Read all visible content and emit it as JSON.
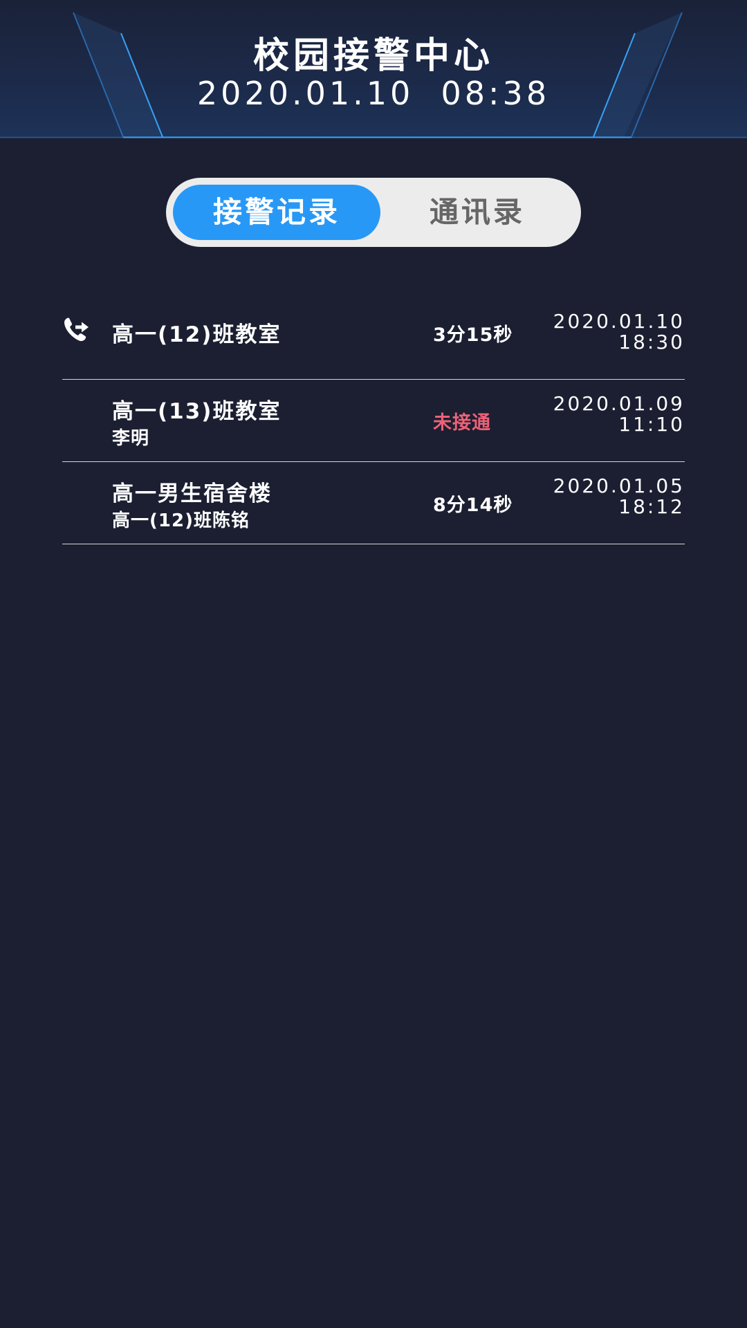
{
  "header": {
    "title": "校园接警中心",
    "datetime": "2020.01.10  08:38"
  },
  "tabs": [
    {
      "label": "接警记录",
      "active": true
    },
    {
      "label": "通讯录",
      "active": false
    }
  ],
  "records": [
    {
      "title": "高一(12)班教室",
      "subtitle": "",
      "status": "3分15秒",
      "missed": false,
      "date": "2020.01.10",
      "time": "18:30",
      "icon": "call-forward-icon"
    },
    {
      "title": "高一(13)班教室",
      "subtitle": "李明",
      "status": "未接通",
      "missed": true,
      "date": "2020.01.09",
      "time": "11:10",
      "icon": ""
    },
    {
      "title": "高一男生宿舍楼",
      "subtitle": "高一(12)班陈铭",
      "status": "8分14秒",
      "missed": false,
      "date": "2020.01.05",
      "time": "18:12",
      "icon": ""
    }
  ],
  "colors": {
    "background": "#1b1f31",
    "accent": "#2898f6",
    "missed": "#ec6278",
    "header_line": "#3aa0f5"
  }
}
